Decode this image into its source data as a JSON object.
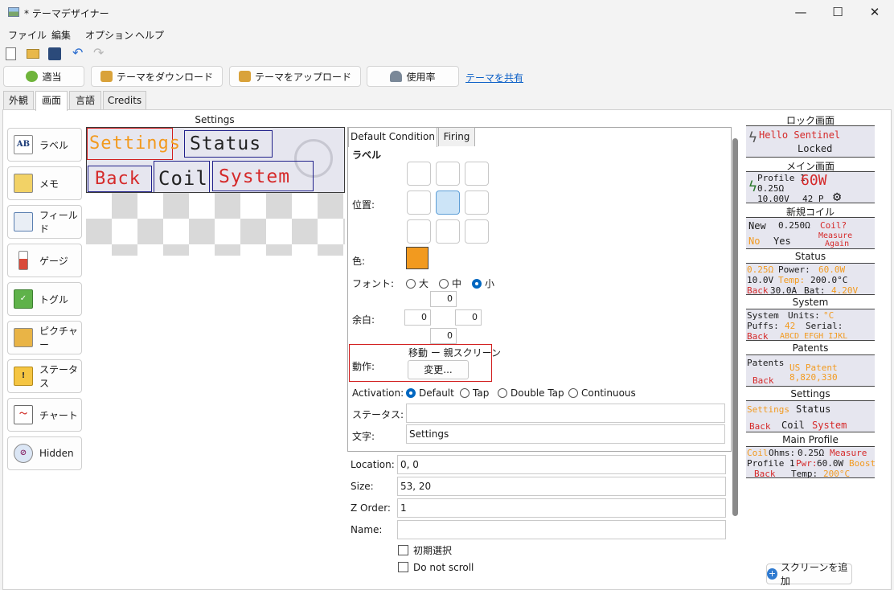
{
  "window": {
    "title": "* テーマデザイナー",
    "minimize": "—",
    "maximize": "☐",
    "close": "✕"
  },
  "menu": [
    "ファイル",
    "編集",
    "オプション",
    "ヘルプ"
  ],
  "toolbar": {
    "apply": "適当",
    "download": "テーマをダウンロード",
    "upload": "テーマをアップロード",
    "usage": "使用率",
    "share": "テーマを共有"
  },
  "tabs": [
    "外観",
    "画面",
    "言語",
    "Credits"
  ],
  "palette": [
    "ラベル",
    "メモ",
    "フィールド",
    "ゲージ",
    "トグル",
    "ピクチャー",
    "ステータス",
    "チャート",
    "Hidden"
  ],
  "canvas": {
    "title": "Settings",
    "tiles": {
      "settings": "Settings",
      "status": "Status",
      "back": "Back",
      "coil": "Coil",
      "system": "System"
    }
  },
  "props": {
    "tabs": [
      "Default Condition",
      "Firing"
    ],
    "section": "ラベル",
    "position_label": "位置:",
    "color_label": "色:",
    "color": "#f29a1f",
    "font_label": "フォント:",
    "font_options": [
      "大",
      "中",
      "小"
    ],
    "font_selected": "小",
    "margin_label": "余白:",
    "margins": {
      "top": "0",
      "left": "0",
      "right": "0",
      "bottom": "0"
    },
    "action_label": "動作:",
    "action_value": "移動 ー 親スクリーン",
    "change_button": "変更...",
    "activation_label": "Activation:",
    "activation_options": [
      "Default",
      "Tap",
      "Double Tap",
      "Continuous"
    ],
    "activation_selected": "Default",
    "status_label": "ステータス:",
    "status_value": "",
    "text_label": "文字:",
    "text_value": "Settings"
  },
  "fields": {
    "location_label": "Location:",
    "location": "0, 0",
    "size_label": "Size:",
    "size": "53, 20",
    "zorder_label": "Z Order:",
    "zorder": "1",
    "name_label": "Name:",
    "name": "",
    "initial_select": "初期選択",
    "no_scroll": "Do not scroll"
  },
  "screens": [
    {
      "title": "ロック画面",
      "lines": [
        "Hello Sentinel",
        "Locked"
      ]
    },
    {
      "title": "メイン画面",
      "lines": [
        "Profile 1",
        "0.25Ω",
        "10.00V",
        "60W",
        "42 P"
      ]
    },
    {
      "title": "新規コイル",
      "lines": [
        "New",
        "0.250Ω",
        "Coil?",
        "No",
        "Yes",
        "Measure",
        "Again"
      ]
    },
    {
      "title": "Status",
      "lines": [
        "0.25Ω",
        "Power:",
        "60.0W",
        "10.0V",
        "Temp:",
        "200.0°C",
        "Back",
        "30.0A",
        "Bat:",
        "4.20V"
      ]
    },
    {
      "title": "System",
      "lines": [
        "System",
        "Units:",
        "°C",
        "Puffs:",
        "42",
        "Serial:",
        "Back",
        "ABCD EFGH IJKL"
      ]
    },
    {
      "title": "Patents",
      "lines": [
        "Patents",
        "US Patent",
        "Back",
        "8,820,330"
      ]
    },
    {
      "title": "Settings",
      "lines": [
        "Settings",
        "Status",
        "Back",
        "Coil",
        "System"
      ]
    },
    {
      "title": "Main Profile",
      "lines": [
        "Coil",
        "Ohms:",
        "0.25Ω",
        "Measure",
        "Profile 1",
        "Pwr:",
        "60.0W",
        "Boost",
        "Back",
        "Temp:",
        "200°C"
      ]
    }
  ],
  "add_screen": "スクリーンを追加"
}
